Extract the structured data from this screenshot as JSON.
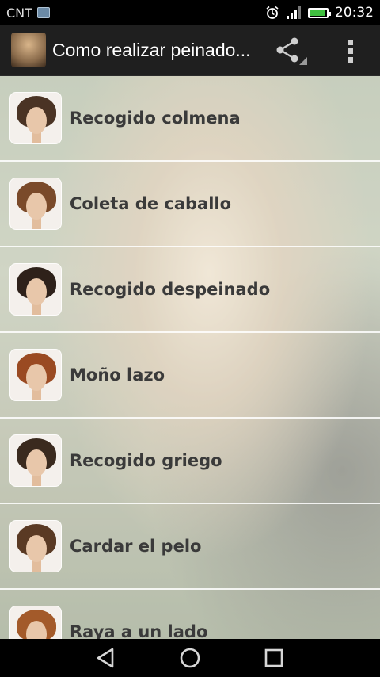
{
  "status_bar": {
    "carrier": "CNT",
    "time": "20:32",
    "battery_level": 0.85,
    "icons": [
      "image-notification-icon",
      "alarm-icon",
      "signal-icon",
      "battery-charging-icon"
    ]
  },
  "action_bar": {
    "title": "Como realizar peinado...",
    "icons": [
      "app-icon",
      "share-icon",
      "overflow-menu-icon"
    ]
  },
  "list": {
    "items": [
      {
        "label": "Recogido colmena",
        "hair_color": "#4a3324"
      },
      {
        "label": "Coleta de caballo",
        "hair_color": "#7a4a2a"
      },
      {
        "label": "Recogido despeinado",
        "hair_color": "#2e211a"
      },
      {
        "label": "Moño lazo",
        "hair_color": "#9a4a22"
      },
      {
        "label": "Recogido griego",
        "hair_color": "#3a2a1e"
      },
      {
        "label": "Cardar el pelo",
        "hair_color": "#5a3a24"
      },
      {
        "label": "Raya a un lado",
        "hair_color": "#a35a2a"
      }
    ]
  },
  "nav_bar": {
    "icons": [
      "back-icon",
      "home-icon",
      "recents-icon"
    ]
  }
}
